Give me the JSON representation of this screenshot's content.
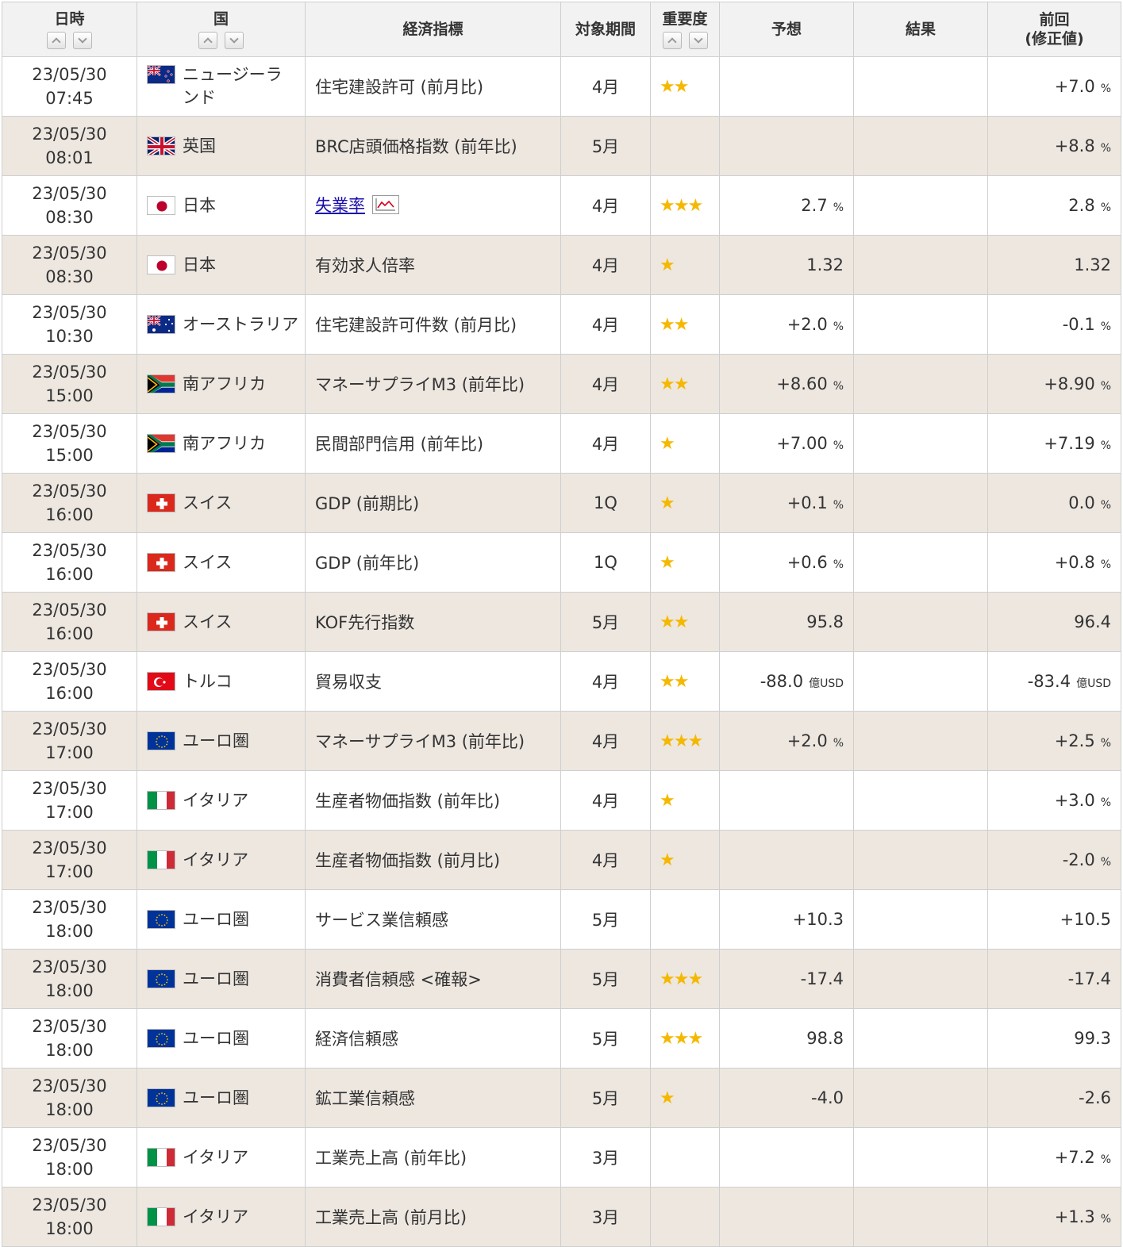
{
  "headers": {
    "datetime": "日時",
    "country": "国",
    "indicator": "経済指標",
    "period": "対象期間",
    "importance": "重要度",
    "forecast": "予想",
    "result": "結果",
    "previous_line1": "前回",
    "previous_line2": "(修正値)"
  },
  "icons": {
    "sort_up": "chevron-up-icon",
    "sort_down": "chevron-down-icon",
    "importance_star": "star-icon",
    "chart_link": "line-chart-icon"
  },
  "colors": {
    "header_bg": "#f2f2f2",
    "row_alt_bg": "#ede7e0",
    "star": "#f5b800",
    "link": "#1a0dab",
    "border": "#cfcfcf"
  },
  "rows": [
    {
      "date": "23/05/30",
      "time": "07:45",
      "flag": "nz",
      "country": "ニュージーランド",
      "indicator": "住宅建設許可 (前月比)",
      "has_chart": false,
      "period": "4月",
      "importance": "★★",
      "forecast": "",
      "forecast_unit": "",
      "result": "",
      "previous": "+7.0",
      "previous_unit": "%"
    },
    {
      "date": "23/05/30",
      "time": "08:01",
      "flag": "gb",
      "country": "英国",
      "indicator": "BRC店頭価格指数 (前年比)",
      "has_chart": false,
      "period": "5月",
      "importance": "",
      "forecast": "",
      "forecast_unit": "",
      "result": "",
      "previous": "+8.8",
      "previous_unit": "%"
    },
    {
      "date": "23/05/30",
      "time": "08:30",
      "flag": "jp",
      "country": "日本",
      "indicator": "失業率",
      "has_chart": true,
      "period": "4月",
      "importance": "★★★",
      "forecast": "2.7",
      "forecast_unit": "%",
      "result": "",
      "previous": "2.8",
      "previous_unit": "%"
    },
    {
      "date": "23/05/30",
      "time": "08:30",
      "flag": "jp",
      "country": "日本",
      "indicator": "有効求人倍率",
      "has_chart": false,
      "period": "4月",
      "importance": "★",
      "forecast": "1.32",
      "forecast_unit": "",
      "result": "",
      "previous": "1.32",
      "previous_unit": ""
    },
    {
      "date": "23/05/30",
      "time": "10:30",
      "flag": "au",
      "country": "オーストラリア",
      "indicator": "住宅建設許可件数 (前月比)",
      "has_chart": false,
      "period": "4月",
      "importance": "★★",
      "forecast": "+2.0",
      "forecast_unit": "%",
      "result": "",
      "previous": "-0.1",
      "previous_unit": "%"
    },
    {
      "date": "23/05/30",
      "time": "15:00",
      "flag": "za",
      "country": "南アフリカ",
      "indicator": "マネーサプライM3 (前年比)",
      "has_chart": false,
      "period": "4月",
      "importance": "★★",
      "forecast": "+8.60",
      "forecast_unit": "%",
      "result": "",
      "previous": "+8.90",
      "previous_unit": "%"
    },
    {
      "date": "23/05/30",
      "time": "15:00",
      "flag": "za",
      "country": "南アフリカ",
      "indicator": "民間部門信用 (前年比)",
      "has_chart": false,
      "period": "4月",
      "importance": "★",
      "forecast": "+7.00",
      "forecast_unit": "%",
      "result": "",
      "previous": "+7.19",
      "previous_unit": "%"
    },
    {
      "date": "23/05/30",
      "time": "16:00",
      "flag": "ch",
      "country": "スイス",
      "indicator": "GDP (前期比)",
      "has_chart": false,
      "period": "1Q",
      "importance": "★",
      "forecast": "+0.1",
      "forecast_unit": "%",
      "result": "",
      "previous": "0.0",
      "previous_unit": "%"
    },
    {
      "date": "23/05/30",
      "time": "16:00",
      "flag": "ch",
      "country": "スイス",
      "indicator": "GDP (前年比)",
      "has_chart": false,
      "period": "1Q",
      "importance": "★",
      "forecast": "+0.6",
      "forecast_unit": "%",
      "result": "",
      "previous": "+0.8",
      "previous_unit": "%"
    },
    {
      "date": "23/05/30",
      "time": "16:00",
      "flag": "ch",
      "country": "スイス",
      "indicator": "KOF先行指数",
      "has_chart": false,
      "period": "5月",
      "importance": "★★",
      "forecast": "95.8",
      "forecast_unit": "",
      "result": "",
      "previous": "96.4",
      "previous_unit": ""
    },
    {
      "date": "23/05/30",
      "time": "16:00",
      "flag": "tr",
      "country": "トルコ",
      "indicator": "貿易収支",
      "has_chart": false,
      "period": "4月",
      "importance": "★★",
      "forecast": "-88.0",
      "forecast_unit": "億USD",
      "result": "",
      "previous": "-83.4",
      "previous_unit": "億USD"
    },
    {
      "date": "23/05/30",
      "time": "17:00",
      "flag": "eu",
      "country": "ユーロ圏",
      "indicator": "マネーサプライM3 (前年比)",
      "has_chart": false,
      "period": "4月",
      "importance": "★★★",
      "forecast": "+2.0",
      "forecast_unit": "%",
      "result": "",
      "previous": "+2.5",
      "previous_unit": "%"
    },
    {
      "date": "23/05/30",
      "time": "17:00",
      "flag": "it",
      "country": "イタリア",
      "indicator": "生産者物価指数 (前年比)",
      "has_chart": false,
      "period": "4月",
      "importance": "★",
      "forecast": "",
      "forecast_unit": "",
      "result": "",
      "previous": "+3.0",
      "previous_unit": "%"
    },
    {
      "date": "23/05/30",
      "time": "17:00",
      "flag": "it",
      "country": "イタリア",
      "indicator": "生産者物価指数 (前月比)",
      "has_chart": false,
      "period": "4月",
      "importance": "★",
      "forecast": "",
      "forecast_unit": "",
      "result": "",
      "previous": "-2.0",
      "previous_unit": "%"
    },
    {
      "date": "23/05/30",
      "time": "18:00",
      "flag": "eu",
      "country": "ユーロ圏",
      "indicator": "サービス業信頼感",
      "has_chart": false,
      "period": "5月",
      "importance": "",
      "forecast": "+10.3",
      "forecast_unit": "",
      "result": "",
      "previous": "+10.5",
      "previous_unit": ""
    },
    {
      "date": "23/05/30",
      "time": "18:00",
      "flag": "eu",
      "country": "ユーロ圏",
      "indicator": "消費者信頼感 <確報>",
      "has_chart": false,
      "period": "5月",
      "importance": "★★★",
      "forecast": "-17.4",
      "forecast_unit": "",
      "result": "",
      "previous": "-17.4",
      "previous_unit": ""
    },
    {
      "date": "23/05/30",
      "time": "18:00",
      "flag": "eu",
      "country": "ユーロ圏",
      "indicator": "経済信頼感",
      "has_chart": false,
      "period": "5月",
      "importance": "★★★",
      "forecast": "98.8",
      "forecast_unit": "",
      "result": "",
      "previous": "99.3",
      "previous_unit": ""
    },
    {
      "date": "23/05/30",
      "time": "18:00",
      "flag": "eu",
      "country": "ユーロ圏",
      "indicator": "鉱工業信頼感",
      "has_chart": false,
      "period": "5月",
      "importance": "★",
      "forecast": "-4.0",
      "forecast_unit": "",
      "result": "",
      "previous": "-2.6",
      "previous_unit": ""
    },
    {
      "date": "23/05/30",
      "time": "18:00",
      "flag": "it",
      "country": "イタリア",
      "indicator": "工業売上高 (前年比)",
      "has_chart": false,
      "period": "3月",
      "importance": "",
      "forecast": "",
      "forecast_unit": "",
      "result": "",
      "previous": "+7.2",
      "previous_unit": "%"
    },
    {
      "date": "23/05/30",
      "time": "18:00",
      "flag": "it",
      "country": "イタリア",
      "indicator": "工業売上高 (前月比)",
      "has_chart": false,
      "period": "3月",
      "importance": "",
      "forecast": "",
      "forecast_unit": "",
      "result": "",
      "previous": "+1.3",
      "previous_unit": "%"
    }
  ]
}
